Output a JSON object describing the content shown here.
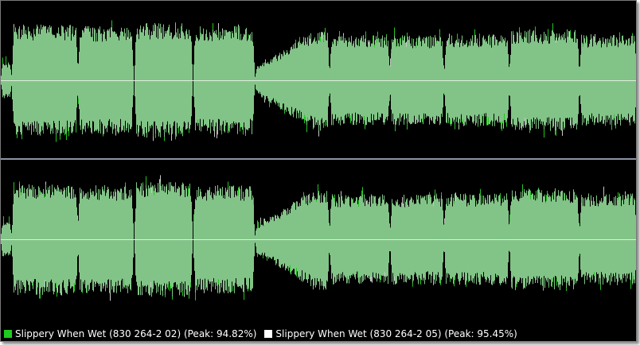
{
  "colors": {
    "background": "#000000",
    "waveform_fill": "#82c487",
    "waveform_peak": "#22c81e",
    "waveform_peak_alt": "#c8c8c8",
    "center_line": "#dff0df",
    "separator": "#8a94a8"
  },
  "legend": {
    "items": [
      {
        "label": "Slippery When Wet (830 264-2 02) (Peak: 94.82%)",
        "swatch_color": "#1ecb1e"
      },
      {
        "label": "Slippery When Wet (830 264-2 05) (Peak: 95.45%)",
        "swatch_color": "#ffffff"
      }
    ]
  },
  "waveform": {
    "channels": [
      "left",
      "right"
    ],
    "segments": [
      {
        "label": "segment-1",
        "level": 0.68,
        "envelope": "flat"
      },
      {
        "label": "segment-2",
        "level": 0.66,
        "envelope": "flat"
      },
      {
        "label": "segment-3",
        "level": 0.7,
        "envelope": "flat"
      },
      {
        "label": "segment-4",
        "level": 0.66,
        "envelope": "flat"
      },
      {
        "label": "segment-5",
        "level": 0.62,
        "envelope": "ramp"
      },
      {
        "label": "segment-6",
        "level": 0.55,
        "envelope": "flat"
      },
      {
        "label": "segment-7",
        "level": 0.55,
        "envelope": "flat"
      },
      {
        "label": "segment-8",
        "level": 0.56,
        "envelope": "flat"
      },
      {
        "label": "segment-9",
        "level": 0.62,
        "envelope": "flat"
      },
      {
        "label": "segment-10",
        "level": 0.56,
        "envelope": "flat"
      },
      {
        "label": "segment-11",
        "level": 0.52,
        "envelope": "flat"
      }
    ]
  }
}
